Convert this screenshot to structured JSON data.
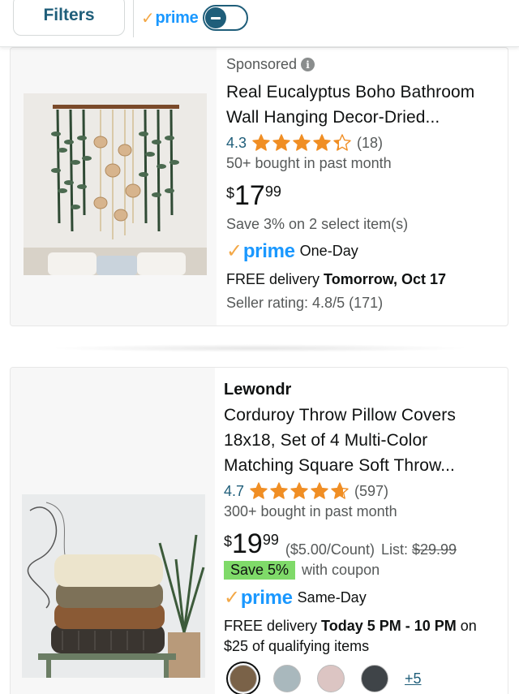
{
  "topbar": {
    "filters_label": "Filters",
    "prime_label": "prime",
    "prime_toggle_state": "off"
  },
  "products": [
    {
      "sponsored_label": "Sponsored",
      "title_line1": "Real Eucalyptus Boho Bathroom",
      "title_line2": "Wall Hanging Decor-Dried...",
      "rating": "4.3",
      "rating_value": 4.3,
      "rating_count": "(18)",
      "bought": "50+ bought in past month",
      "price_symbol": "$",
      "price_whole": "17",
      "price_fraction": "99",
      "save_text": "Save 3% on 2 select item(s)",
      "prime_label": "prime",
      "prime_speed": "One-Day",
      "delivery_prefix": "FREE delivery ",
      "delivery_bold": "Tomorrow, Oct 17",
      "seller_rating": "Seller rating: 4.8/5 (171)"
    },
    {
      "brand": "Lewondr",
      "title_line1": "Corduroy Throw Pillow Covers",
      "title_line2": "18x18, Set of 4 Multi-Color",
      "title_line3": "Matching Square Soft Throw...",
      "rating": "4.7",
      "rating_value": 4.7,
      "rating_count": "(597)",
      "bought": "300+ bought in past month",
      "price_symbol": "$",
      "price_whole": "19",
      "price_fraction": "99",
      "unit_price": "($5.00/Count)",
      "list_label": "List: ",
      "list_price": "$29.99",
      "coupon_badge": "Save 5%",
      "coupon_text": "with coupon",
      "prime_label": "prime",
      "prime_speed": "Same-Day",
      "delivery_prefix": "FREE delivery ",
      "delivery_bold": "Today 5 PM - 10 PM",
      "delivery_suffix": " on",
      "delivery_line2": "$25 of qualifying items",
      "swatch_colors": [
        "#7a6248",
        "#a9b8bd",
        "#dcc5c3",
        "#3f4448"
      ],
      "more_swatches": "+5"
    }
  ],
  "colors": {
    "accent_teal": "#1f5e7a",
    "prime_blue": "#1a98ff",
    "prime_check": "#f3a847",
    "star_orange": "#f08e24",
    "coupon_green": "#7fda69"
  }
}
